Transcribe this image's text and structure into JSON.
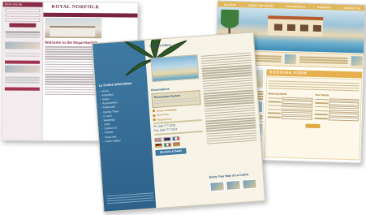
{
  "royal_norfolk": {
    "site_title": "ROYAL NORFOLK",
    "sidebar_header": "BOOK ONLINE",
    "welcome_heading": "Welcome to the Royal Norfolk"
  },
  "la_colina": {
    "sidebar_title": "La Colina Information",
    "menu_items": [
      "Home",
      "Amenities",
      "Suites",
      "Reservations",
      "Restaurant",
      "Getting There",
      "In town",
      "Weddings",
      "Links",
      "Contact Us",
      "Policies",
      "Press Info",
      "Photo Gallery"
    ],
    "header_title": "Hotel La Colina",
    "reservation_box_label": "Reservation System",
    "links": [
      "Check Availability",
      "Book Now",
      "Request Info"
    ],
    "phone_1": "Ph: 506-777-0231",
    "phone_2": "Fax: 506-777-1553",
    "specials_button": "Specials & Deals",
    "stay_heading": "Enjoy Your Stay at La Colina",
    "section_heading": "Reservations"
  },
  "booking_site": {
    "nav_items": [
      "GALLERY",
      "ABOUT THE ROOMS",
      "TESTIMONIALS",
      "BOOKINGS",
      "CONTACT US"
    ],
    "calendar_day": "17",
    "form_header": "BOOKING FORM",
    "booking_details_label": "Booking Details",
    "contact_details_label": "Your Details"
  }
}
